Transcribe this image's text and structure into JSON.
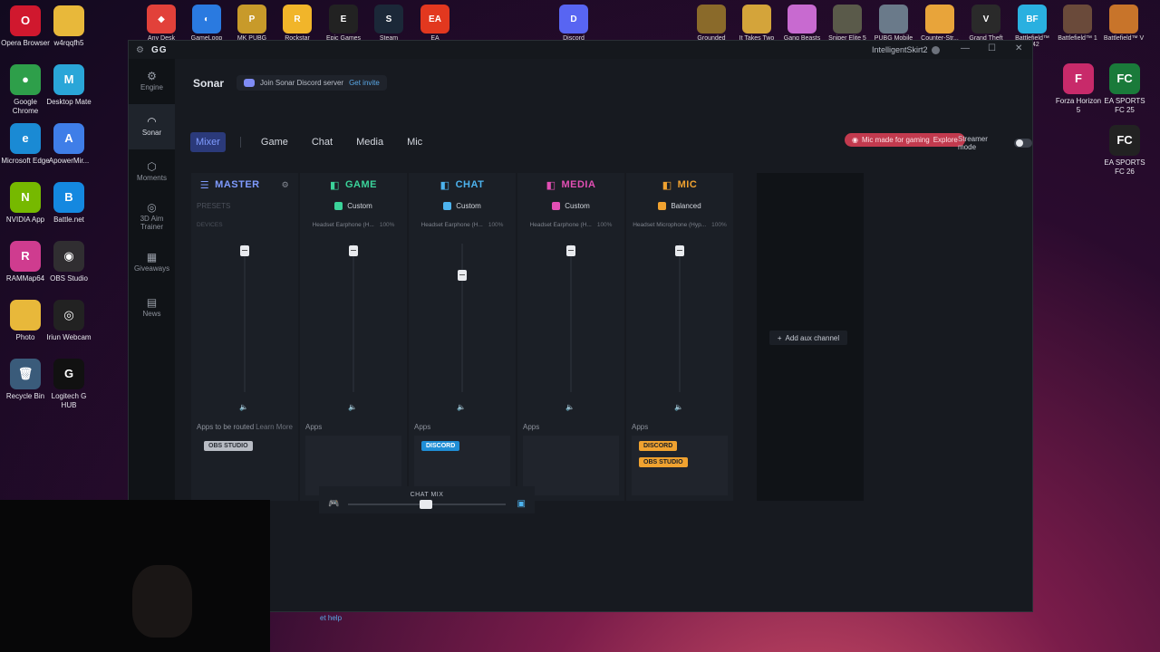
{
  "desktop": {
    "left_icons": [
      {
        "label": "Opera Browser",
        "color": "#d0182e",
        "glyph": "O"
      },
      {
        "label": "w4rqqfh5",
        "color": "#e8b83a",
        "glyph": ""
      },
      {
        "label": "Google Chrome",
        "color": "#2e9f4a",
        "glyph": "●"
      },
      {
        "label": "Desktop Mate",
        "color": "#2aa6d8",
        "glyph": "M"
      },
      {
        "label": "Microsoft Edge",
        "color": "#1a8ad4",
        "glyph": "e"
      },
      {
        "label": "ApowerMir...",
        "color": "#3f7ee8",
        "glyph": "A"
      },
      {
        "label": "NVIDIA App",
        "color": "#76b900",
        "glyph": "N"
      },
      {
        "label": "Battle.net",
        "color": "#1488e0",
        "glyph": "B"
      },
      {
        "label": "RAMMap64",
        "color": "#cf3c8f",
        "glyph": "R"
      },
      {
        "label": "OBS Studio",
        "color": "#302e31",
        "glyph": "◉"
      },
      {
        "label": "Photo",
        "color": "#e8b83a",
        "glyph": ""
      },
      {
        "label": "Iriun Webcam",
        "color": "#222",
        "glyph": "◎"
      },
      {
        "label": "Recycle Bin",
        "color": "#3a5b7a",
        "glyph": "🗑"
      },
      {
        "label": "Logitech G HUB",
        "color": "#111",
        "glyph": "G"
      }
    ],
    "top_icons": [
      {
        "label": "Any Desk",
        "color": "#e2413a",
        "glyph": "◆"
      },
      {
        "label": "GameLoop",
        "color": "#2a7ae0",
        "glyph": "◐"
      },
      {
        "label": "MK PUBG",
        "color": "#c89a2a",
        "glyph": "P"
      },
      {
        "label": "Rockstar",
        "color": "#f1b52a",
        "glyph": "R"
      },
      {
        "label": "Epic Games",
        "color": "#222",
        "glyph": "E"
      },
      {
        "label": "Steam",
        "color": "#1b2838",
        "glyph": "S"
      },
      {
        "label": "EA",
        "color": "#e2381f",
        "glyph": "EA"
      },
      {
        "label": "Discord",
        "color": "#5865f2",
        "glyph": "D"
      },
      {
        "label": "Grounded",
        "color": "#8a6a2a",
        "glyph": ""
      },
      {
        "label": "It Takes Two",
        "color": "#d4a43a",
        "glyph": ""
      },
      {
        "label": "Gang Beasts",
        "color": "#c86ad0",
        "glyph": ""
      },
      {
        "label": "Sniper Elite 5",
        "color": "#5a5a4a",
        "glyph": ""
      },
      {
        "label": "PUBG Mobile",
        "color": "#6a7a8a",
        "glyph": ""
      },
      {
        "label": "Counter-Str...",
        "color": "#e8a43a",
        "glyph": ""
      },
      {
        "label": "Grand Theft",
        "color": "#2a2a2a",
        "glyph": "V"
      },
      {
        "label": "Battlefield™ 2042",
        "color": "#2ab0e0",
        "glyph": "BF"
      },
      {
        "label": "Battlefield™ 1",
        "color": "#6a4a3a",
        "glyph": ""
      },
      {
        "label": "Battlefield™ V",
        "color": "#c8742a",
        "glyph": ""
      }
    ],
    "right_icons": [
      {
        "label": "Forza Horizon 5",
        "color": "#c82a6a",
        "glyph": "F"
      },
      {
        "label": "EA SPORTS FC 25",
        "color": "#1a7a3a",
        "glyph": "FC"
      },
      {
        "label": "EA SPORTS FC 26",
        "color": "#222",
        "glyph": "FC"
      }
    ]
  },
  "window": {
    "logo": "GG",
    "username": "IntelligentSkirt2",
    "controls": [
      "—",
      "☐",
      "✕"
    ]
  },
  "sidebar": {
    "items": [
      {
        "label": "Engine",
        "icon": "⚙"
      },
      {
        "label": "Sonar",
        "icon": "◠"
      },
      {
        "label": "Moments",
        "icon": "⬡"
      },
      {
        "label": "3D Aim Trainer",
        "icon": "◎"
      },
      {
        "label": "Giveaways",
        "icon": "▦"
      },
      {
        "label": "News",
        "icon": "▤"
      }
    ]
  },
  "header": {
    "title": "Sonar",
    "invite_text": "Join Sonar Discord server",
    "invite_link": "Get invite"
  },
  "tabs": [
    "Mixer",
    "Game",
    "Chat",
    "Media",
    "Mic"
  ],
  "mic_pill": {
    "text": "Mic made for gaming",
    "link": "Explore"
  },
  "streamer_mode": "Streamer mode",
  "mixer": {
    "presets_label": "PRESETS",
    "devices_label": "DEVICES",
    "master": {
      "name": "MASTER",
      "color": "#7f9bff",
      "apps_label": "Apps to be routed",
      "learn_more": "Learn More",
      "apps": [
        {
          "name": "OBS STUDIO",
          "bg": "#b8bcc4",
          "fg": "#2a2e36"
        }
      ]
    },
    "channels": [
      {
        "name": "GAME",
        "color": "#3bd39a",
        "preset": "Custom",
        "device": "Headset Earphone (H...",
        "volume": "100%",
        "apps_label": "Apps",
        "apps": []
      },
      {
        "name": "CHAT",
        "color": "#4db3ee",
        "preset": "Custom",
        "device": "Headset Earphone (H...",
        "volume": "100%",
        "apps_label": "Apps",
        "apps": [
          {
            "name": "DISCORD",
            "bg": "#1f8ed6",
            "fg": "#ffffff"
          }
        ]
      },
      {
        "name": "MEDIA",
        "color": "#e24fb4",
        "preset": "Custom",
        "device": "Headset Earphone (H...",
        "volume": "100%",
        "apps_label": "Apps",
        "apps": []
      },
      {
        "name": "MIC",
        "color": "#f0a230",
        "preset": "Balanced",
        "device": "Headset Microphone (Hyp...",
        "volume": "100%",
        "apps_label": "Apps",
        "apps": [
          {
            "name": "DISCORD",
            "bg": "#f0a230",
            "fg": "#1b1f26"
          },
          {
            "name": "OBS STUDIO",
            "bg": "#f0a230",
            "fg": "#1b1f26"
          }
        ]
      }
    ],
    "add_aux": "Add aux channel",
    "chatmix_label": "CHAT MIX"
  },
  "help_text": "et help"
}
